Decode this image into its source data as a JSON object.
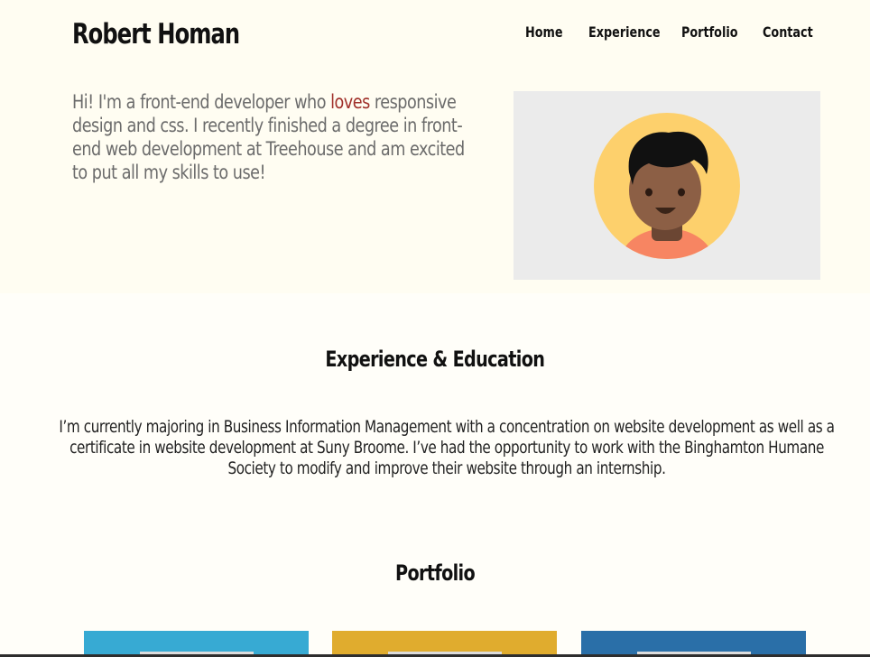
{
  "header": {
    "site_title": "Robert Homan",
    "nav": [
      "Home",
      "Experience",
      "Portfolio",
      "Contact"
    ]
  },
  "intro": {
    "before": "Hi! I'm a front-end developer who ",
    "highlight": "loves",
    "after": " responsive design and css. I recently finished a degree in front-end web development at Treehouse and am excited to put all my skills to use!"
  },
  "experience": {
    "heading": "Experience & Education",
    "text": "I’m currently majoring in Business Information Management with a concentration on website development as well as a certificate in website development at Suny Broome. I’ve had the opportunity to work with the Binghamton Humane Society to modify and improve their website through an internship."
  },
  "portfolio": {
    "heading": "Portfolio",
    "tiles": [
      {
        "color": "#37aad3"
      },
      {
        "color": "#e0ac2e"
      },
      {
        "color": "#2a6fa8"
      }
    ]
  },
  "colors": {
    "accent": "#a0302a",
    "hero_bg": "#fffdf2",
    "avatar_bg": "#ebebeb",
    "avatar_circle": "#fdd06c",
    "skin": "#8c5f45",
    "shirt": "#f78562"
  }
}
